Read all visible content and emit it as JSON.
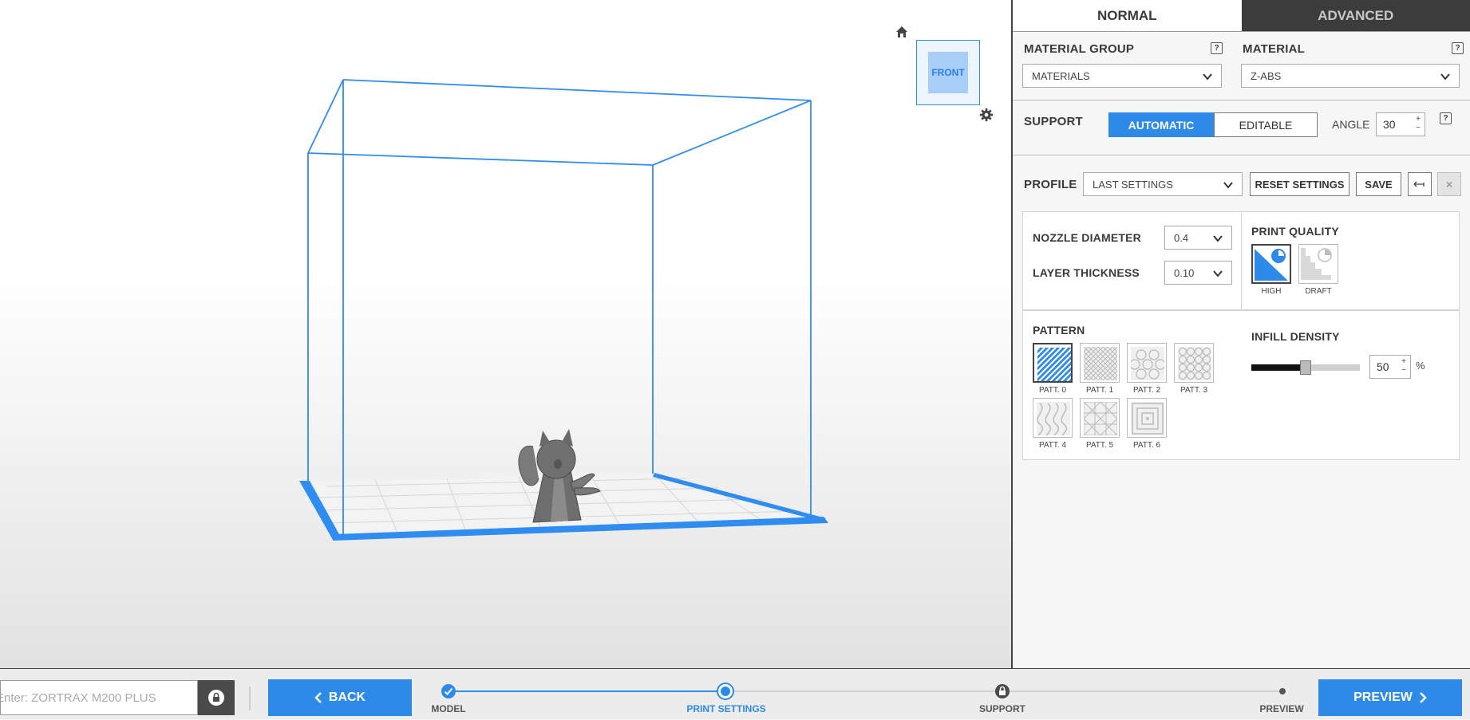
{
  "viewport": {
    "view_cube_face": "FRONT",
    "icons": {
      "home": "home-icon",
      "settings": "gear-icon"
    }
  },
  "tabs": [
    {
      "label": "NORMAL",
      "active": true
    },
    {
      "label": "ADVANCED",
      "active": false
    }
  ],
  "material": {
    "group_label": "MATERIAL GROUP",
    "group_value": "MATERIALS",
    "material_label": "MATERIAL",
    "material_value": "Z-ABS",
    "help": "?"
  },
  "support": {
    "label": "SUPPORT",
    "automatic": "AUTOMATIC",
    "editable": "EDITABLE",
    "selected": "AUTOMATIC",
    "angle_label": "ANGLE",
    "angle_value": "30",
    "help": "?"
  },
  "profile": {
    "label": "PROFILE",
    "value": "LAST SETTINGS",
    "reset": "RESET SETTINGS",
    "save": "SAVE"
  },
  "settings": {
    "nozzle_label": "NOZZLE DIAMETER",
    "nozzle_value": "0.4",
    "layer_label": "LAYER THICKNESS",
    "layer_value": "0.10",
    "quality_label": "PRINT QUALITY",
    "quality_options": [
      {
        "label": "HIGH",
        "selected": true
      },
      {
        "label": "DRAFT",
        "selected": false
      }
    ]
  },
  "pattern": {
    "label": "PATTERN",
    "items": [
      "PATT. 0",
      "PATT. 1",
      "PATT. 2",
      "PATT. 3",
      "PATT. 4",
      "PATT. 5",
      "PATT. 6"
    ],
    "selected": "PATT. 0"
  },
  "infill": {
    "label": "INFILL DENSITY",
    "value": "50",
    "level": 0.5,
    "unit": "%"
  },
  "bottom": {
    "printer_placeholder": "Enter: ZORTRAX M200 PLUS",
    "back": "BACK",
    "preview": "PREVIEW",
    "steps": [
      {
        "label": "MODEL",
        "state": "done"
      },
      {
        "label": "PRINT SETTINGS",
        "state": "current"
      },
      {
        "label": "SUPPORT",
        "state": "locked"
      },
      {
        "label": "PREVIEW",
        "state": "pending"
      }
    ]
  },
  "colors": {
    "accent": "#2d8ae8",
    "dark_tab": "#3c3c3c",
    "wireframe": "#2f8cf0"
  }
}
